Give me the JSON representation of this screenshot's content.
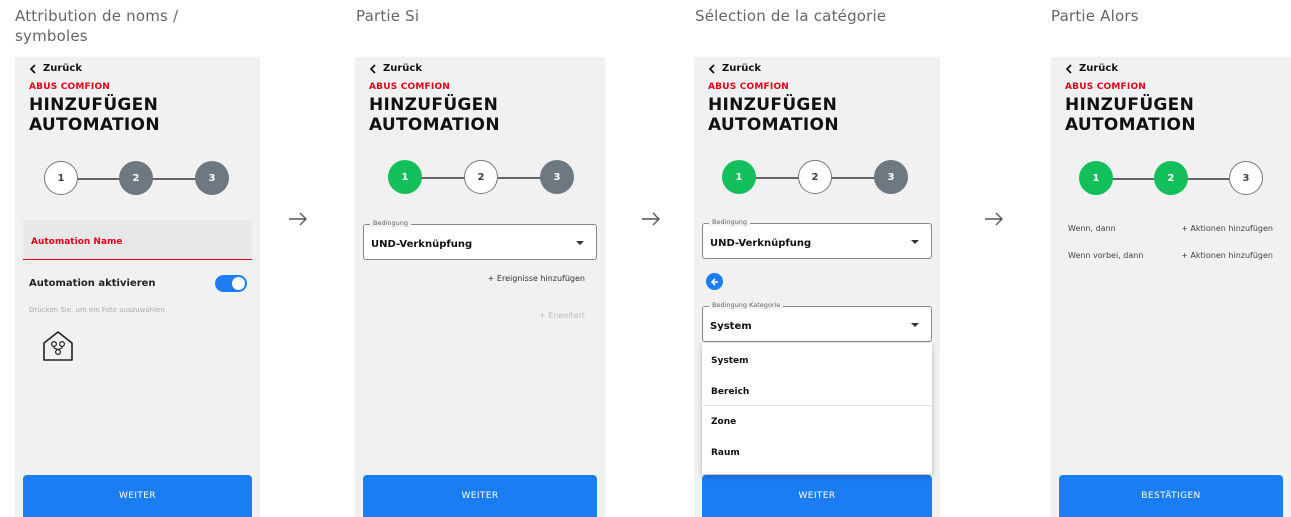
{
  "captions": [
    "Attribution de noms /\nsymboles",
    "Partie Si",
    "Sélection de la catégorie",
    "Partie Alors"
  ],
  "common": {
    "back_label": "Zurück",
    "brand": "ABUS COMFION",
    "title": "HINZUFÜGEN AUTOMATION"
  },
  "screen1": {
    "steps": [
      "1",
      "2",
      "3"
    ],
    "name_label": "Automation Name",
    "activate_label": "Automation aktivieren",
    "photo_hint": "Drücken Sie, um ein Foto auszuwählen",
    "button": "WEITER"
  },
  "screen2": {
    "steps": [
      "1",
      "2",
      "3"
    ],
    "condition_legend": "Bedingung",
    "condition_value": "UND-Verknüpfung",
    "add_events": "+ Ereignisse hinzufügen",
    "advanced": "+ Erweitert",
    "button": "WEITER"
  },
  "screen3": {
    "steps": [
      "1",
      "2",
      "3"
    ],
    "condition_legend": "Bedingung",
    "condition_value": "UND-Verknüpfung",
    "category_legend": "Bedingung Kategorie",
    "category_value": "System",
    "options": [
      "System",
      "Bereich",
      "Zone",
      "Raum"
    ],
    "button": "WEITER"
  },
  "screen4": {
    "steps": [
      "1",
      "2",
      "3"
    ],
    "rows": [
      {
        "label": "Wenn, dann",
        "action": "+ Aktionen hinzufügen"
      },
      {
        "label": "Wenn vorbei, dann",
        "action": "+ Aktionen hinzufügen"
      }
    ],
    "button": "BESTÄTIGEN"
  },
  "colors": {
    "accent_red": "#e2001a",
    "step_done": "#12bf5b",
    "step_todo": "#6f7780",
    "primary_blue": "#1a7df4"
  }
}
